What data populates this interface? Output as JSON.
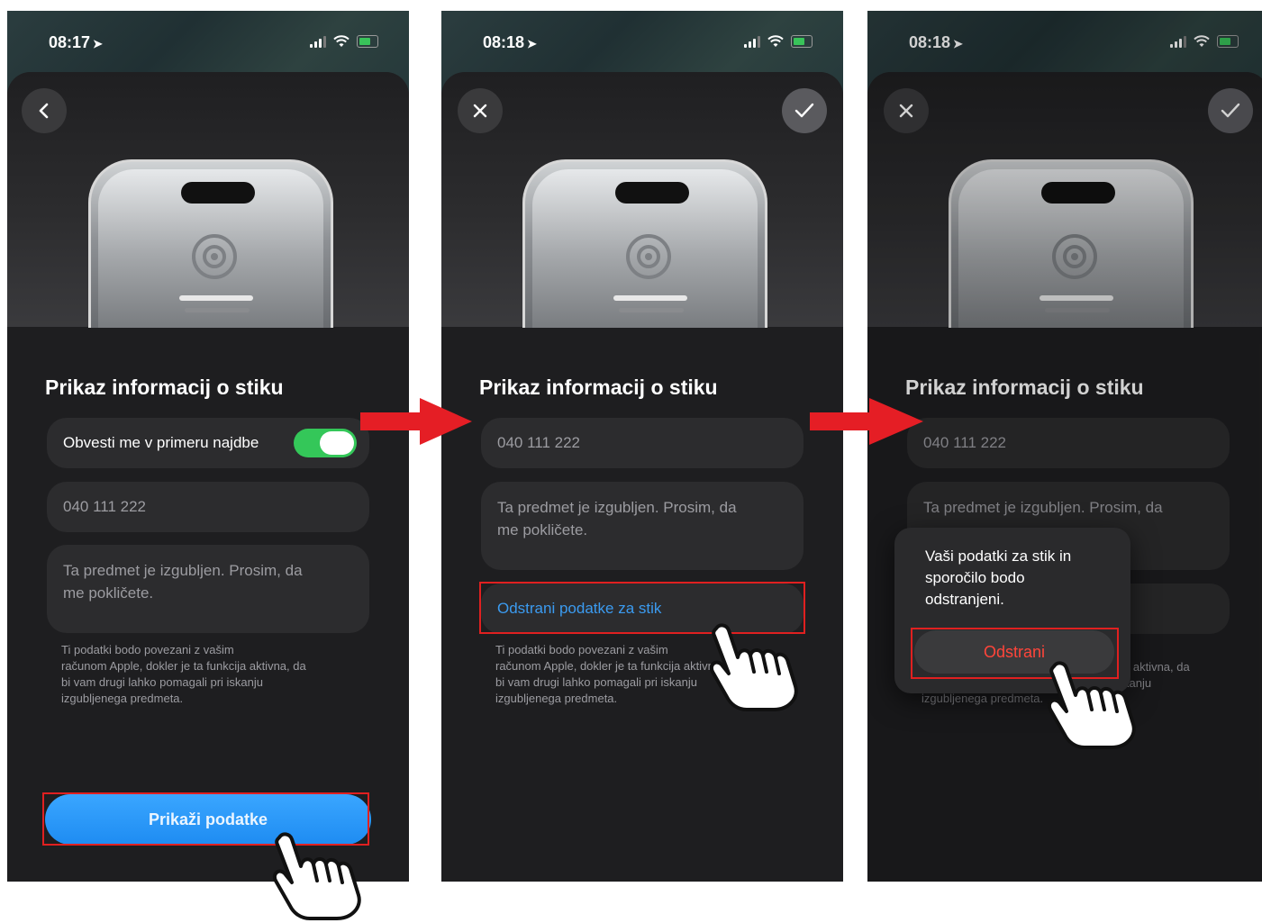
{
  "colors": {
    "accent_blue": "#1e8cf2",
    "toggle_green": "#34c759",
    "destructive_red": "#ff453a",
    "highlight_red": "#e02020",
    "background_dark": "#1e1e20"
  },
  "screens": [
    {
      "status": {
        "time": "08:17"
      },
      "nav": {
        "left_icon": "chevron-left-icon"
      },
      "title": "Prikaz informacij o stiku",
      "toggle_row": {
        "label": "Obvesti me v primeru najdbe",
        "state": "on"
      },
      "phone_field": {
        "value": "040 111 222"
      },
      "message_field": {
        "value": "Ta predmet je izgubljen. Prosim, da\nme pokličete."
      },
      "note": "Ti podatki bodo povezani z vašim\nračunom Apple, dokler je ta funkcija aktivna, da\nbi vam drugi lahko pomagali pri iskanju\nizgubljenega predmeta.",
      "primary_button": "Prikaži podatke"
    },
    {
      "status": {
        "time": "08:18"
      },
      "nav": {
        "left_icon": "close-icon",
        "right_icon": "checkmark-icon"
      },
      "title": "Prikaz informacij o stiku",
      "phone_field": {
        "value": "040 111 222"
      },
      "message_field": {
        "value": "Ta predmet je izgubljen. Prosim, da\nme pokličete."
      },
      "remove_link": "Odstrani podatke za stik",
      "note": "Ti podatki bodo povezani z vašim\nračunom Apple, dokler je ta funkcija aktivna, da\nbi vam drugi lahko pomagali pri iskanju\nizgubljenega predmeta."
    },
    {
      "status": {
        "time": "08:18"
      },
      "nav": {
        "left_icon": "close-icon",
        "right_icon": "checkmark-icon"
      },
      "title": "Prikaz informacij o stiku",
      "phone_field": {
        "value": "040 111 222"
      },
      "message_field": {
        "value": "Ta predmet je izgubljen. Prosim, da"
      },
      "note_tail_1": "a aktivna, da",
      "note_tail_2": "kanju",
      "note_last": "izgubljenega predmeta.",
      "popup": {
        "message": "Vaši podatki za stik in\nsporočilo bodo\nodstranjeni.",
        "confirm_button": "Odstrani"
      }
    }
  ]
}
